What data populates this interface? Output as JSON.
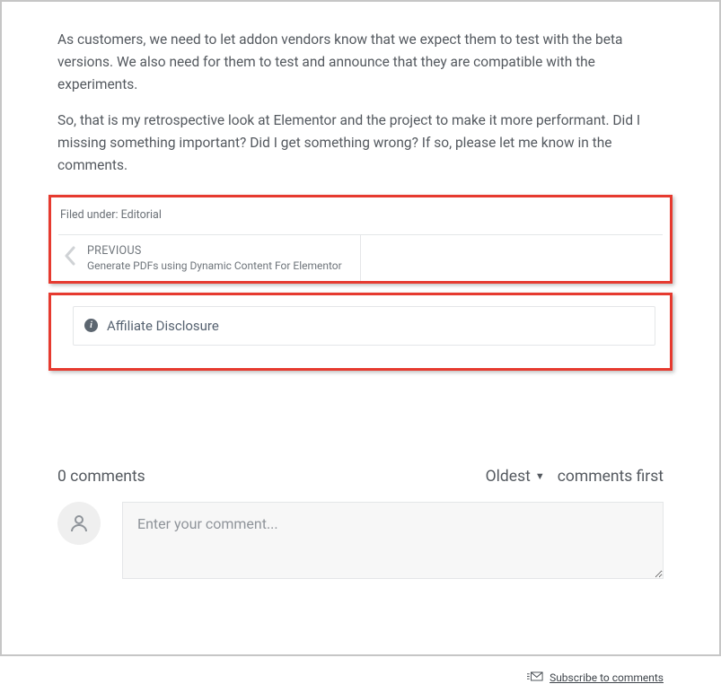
{
  "article": {
    "p1": "As customers, we need to let addon vendors know that we expect them to test with the beta versions. We also need for them to test and announce that they are compatible with the experiments.",
    "p2": "So, that is my retrospective look at Elementor and the project to make it more performant. Did I missing something important? Did I get something wrong? If so, please let me know in the comments."
  },
  "meta": {
    "filed_label": "Filed under: ",
    "filed_category": "Editorial"
  },
  "nav": {
    "prev_label": "PREVIOUS",
    "prev_title": "Generate PDFs using Dynamic Content For Elementor"
  },
  "disclosure": {
    "label": "Affiliate Disclosure"
  },
  "comments": {
    "count_label": "0 comments",
    "sort_option": "Oldest",
    "sort_suffix": "comments first",
    "placeholder": "Enter your comment...",
    "subscribe_label": "Subscribe to comments"
  }
}
